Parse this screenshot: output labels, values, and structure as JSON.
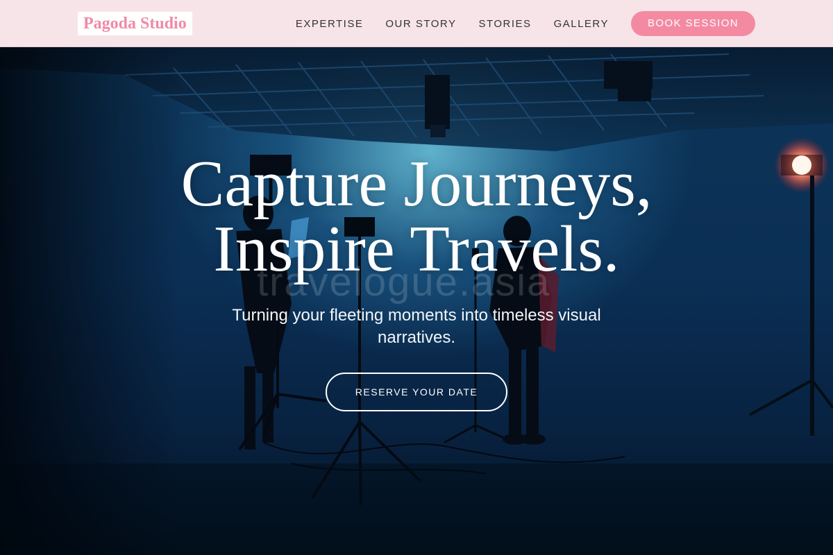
{
  "brand": {
    "name": "Pagoda Studio",
    "accent_color": "#f48aa2",
    "nav_background": "#f7e4e9"
  },
  "nav": {
    "links": [
      {
        "label": "EXPERTISE"
      },
      {
        "label": "OUR STORY"
      },
      {
        "label": "STORIES"
      },
      {
        "label": "GALLERY"
      }
    ],
    "cta_label": "BOOK SESSION"
  },
  "hero": {
    "title_line1": "Capture Journeys,",
    "title_line2": "Inspire Travels.",
    "subtitle": "Turning your fleeting moments into timeless visual narratives.",
    "cta_label": "RESERVE YOUR DATE",
    "watermark": "travelogue.asia",
    "background_scene": "film-studio-silhouettes"
  }
}
